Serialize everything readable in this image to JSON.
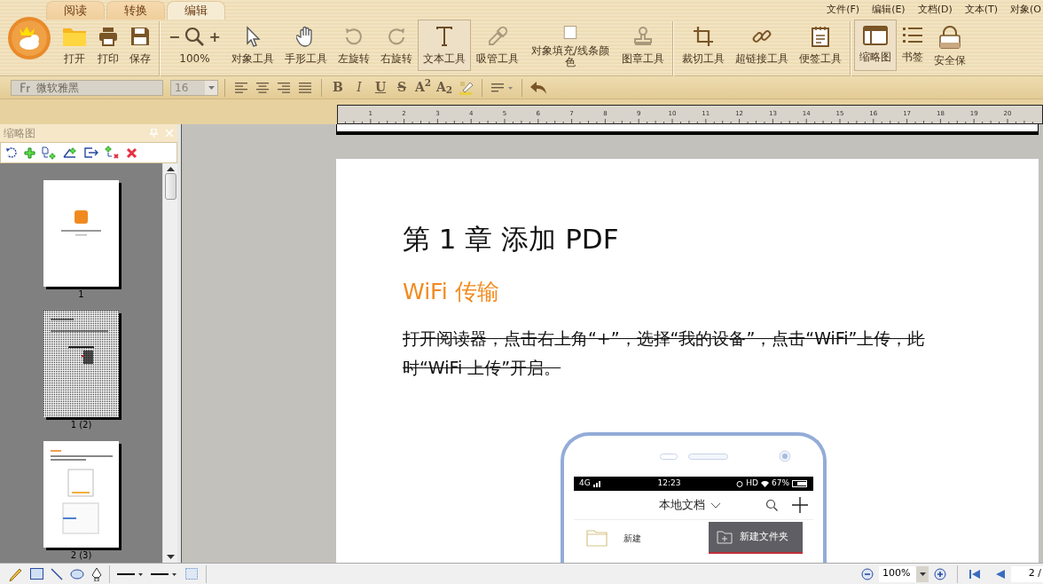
{
  "tabs": [
    {
      "label": "阅读",
      "selected": false
    },
    {
      "label": "转换",
      "selected": false
    },
    {
      "label": "编辑",
      "selected": true
    }
  ],
  "menu": [
    "文件(F)",
    "编辑(E)",
    "文档(D)",
    "文本(T)",
    "对象(O"
  ],
  "ribbon_groups": [
    {
      "buttons": [
        {
          "kind": "open",
          "label": "打开",
          "selected": false
        },
        {
          "kind": "print",
          "label": "打印",
          "selected": false
        },
        {
          "kind": "save",
          "label": "保存",
          "selected": false
        }
      ]
    },
    {
      "buttons": [
        {
          "kind": "zoom",
          "minus": "−",
          "plus": "+",
          "label": "100%",
          "selected": false
        },
        {
          "kind": "select",
          "label": "对象工具",
          "selected": false
        },
        {
          "kind": "hand",
          "label": "手形工具",
          "selected": false
        },
        {
          "kind": "rotate_left",
          "label": "左旋转",
          "selected": false
        },
        {
          "kind": "rotate_right",
          "label": "右旋转",
          "selected": false
        },
        {
          "kind": "text",
          "label": "文本工具",
          "selected": true
        },
        {
          "kind": "eyedropper",
          "label": "吸管工具",
          "selected": false
        },
        {
          "kind": "fill",
          "label": "对象填充/线条颜色",
          "selected": false
        },
        {
          "kind": "stamp",
          "label": "图章工具",
          "selected": false
        }
      ]
    },
    {
      "buttons": [
        {
          "kind": "crop",
          "label": "裁切工具",
          "selected": false
        },
        {
          "kind": "link",
          "label": "超链接工具",
          "selected": false
        },
        {
          "kind": "note",
          "label": "便签工具",
          "selected": false
        }
      ]
    },
    {
      "buttons": [
        {
          "kind": "thumbnails",
          "label": "缩略图",
          "selected": true
        },
        {
          "kind": "bookmarks",
          "label": "书签",
          "selected": false
        },
        {
          "kind": "lock",
          "label": "安全保",
          "selected": false
        }
      ]
    }
  ],
  "format_bar": {
    "font": "微软雅黑",
    "size": "16",
    "styles": [
      {
        "kind": "bold",
        "label": "B"
      },
      {
        "kind": "italic",
        "label": "I"
      },
      {
        "kind": "underline",
        "label": "U"
      },
      {
        "kind": "strike",
        "label": "S"
      },
      {
        "kind": "super",
        "label": "A$^{2}$"
      },
      {
        "kind": "sub",
        "label": "A$_{2}$"
      }
    ]
  },
  "ruler": {
    "labels": [
      "1",
      "2",
      "3",
      "4",
      "5",
      "6",
      "7",
      "8",
      "9",
      "10",
      "11",
      "12",
      "13",
      "14",
      "15",
      "16",
      "17",
      "18",
      "19",
      "20"
    ]
  },
  "thumbnail_panel": {
    "title": "缩略图",
    "thumbnails": [
      {
        "kind": "cover",
        "label": "1",
        "selected": false
      },
      {
        "kind": "figure",
        "label": "1 (2)",
        "selected": true
      },
      {
        "kind": "phone",
        "label": "2 (3)",
        "selected": false
      }
    ]
  },
  "document": {
    "heading": "第 1 章 添加 PDF",
    "subheading": "WiFi 传输",
    "paragraph": "打开阅读器，点击右上角“+”，选择“我的设备”，点击“WiFi”上传，此时“WiFi 上传”开启。",
    "paragraph_struck": true,
    "illustration": {
      "network": "4G",
      "time": "12:23",
      "status": "HD",
      "battery": "67%",
      "title": "本地文档",
      "menu_item": "新建文件夹",
      "folder": "新建"
    }
  },
  "status_bar": {
    "zoom": "100%",
    "page": "2 /"
  }
}
